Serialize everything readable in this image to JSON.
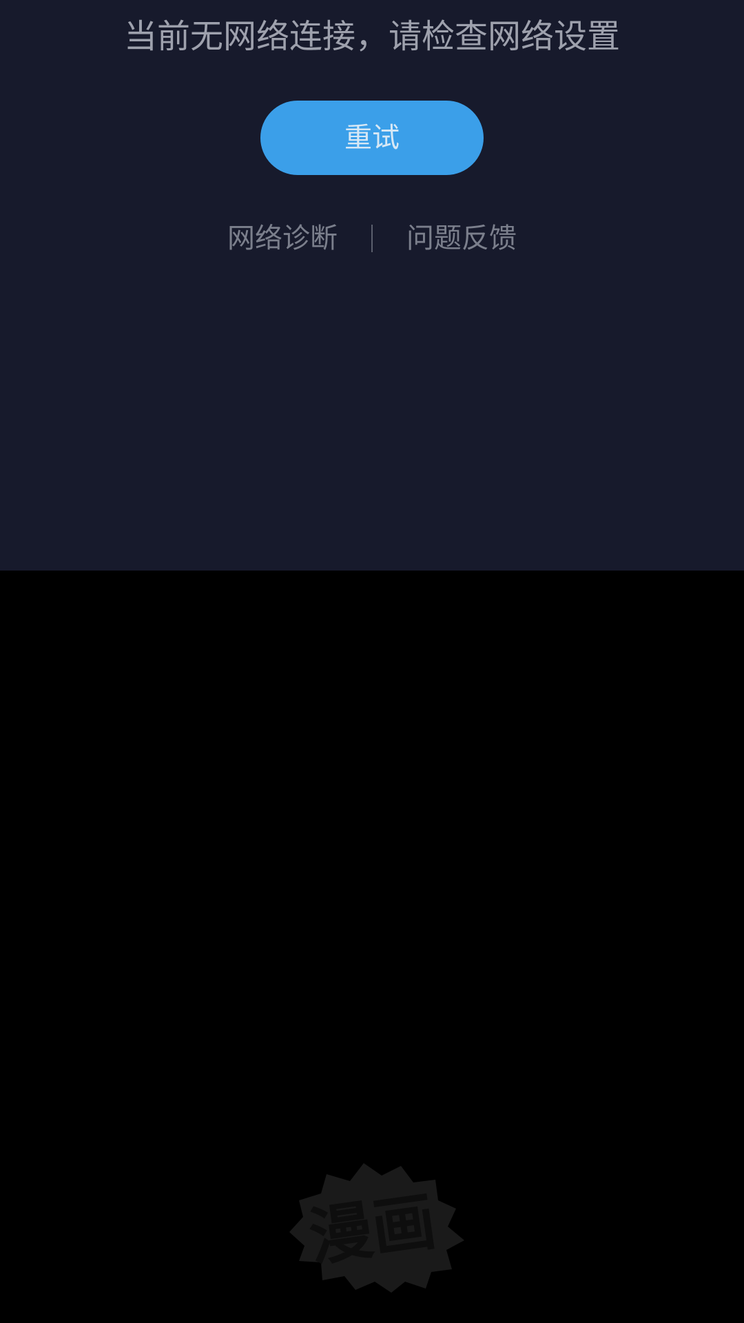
{
  "error": {
    "message": "当前无网络连接，请检查网络设置",
    "retry_label": "重试"
  },
  "links": {
    "diagnose_label": "网络诊断",
    "feedback_label": "问题反馈"
  },
  "watermark": {
    "text": "漫画",
    "icon": "comic-burst-logo-icon"
  },
  "colors": {
    "panel_background": "#171a2c",
    "screen_background": "#000000",
    "accent": "#3b9fe9",
    "message_text": "#9ea1ad",
    "link_text": "#7b7f8c",
    "watermark": "#1a1a1a"
  }
}
